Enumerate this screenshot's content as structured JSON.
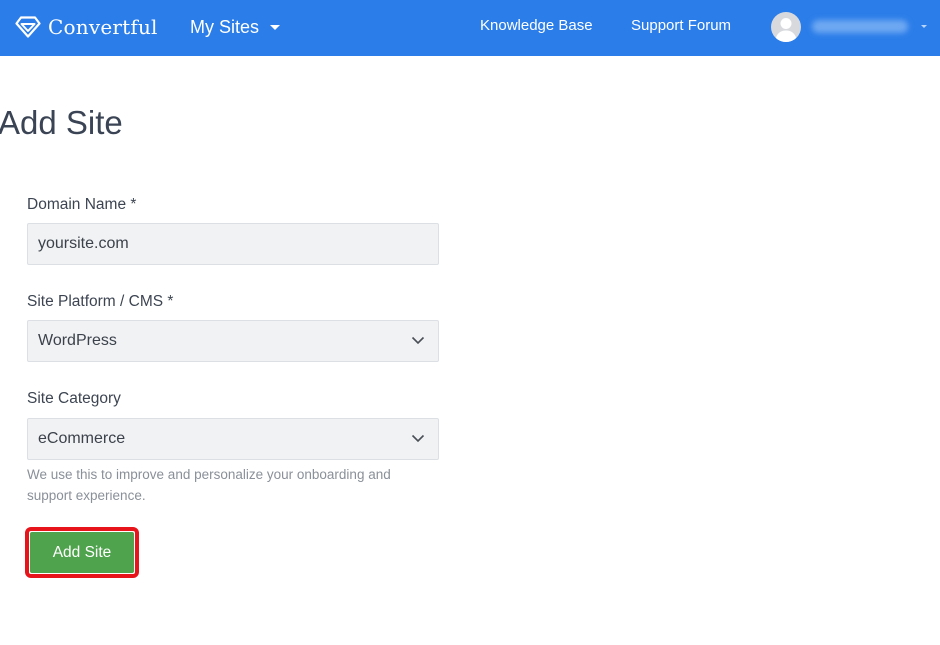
{
  "header": {
    "brand_name": "Convertful",
    "sites_menu_label": "My Sites",
    "nav_links": [
      {
        "label": "Knowledge Base"
      },
      {
        "label": "Support Forum"
      }
    ]
  },
  "page": {
    "title": "Add Site"
  },
  "form": {
    "domain": {
      "label": "Domain Name *",
      "value": "yoursite.com"
    },
    "platform": {
      "label": "Site Platform / CMS *",
      "selected": "WordPress"
    },
    "category": {
      "label": "Site Category",
      "selected": "eCommerce",
      "help": "We use this to improve and personalize your onboarding and support experience."
    },
    "submit_label": "Add Site"
  },
  "colors": {
    "header_bg": "#2b7de9",
    "button_bg": "#4ea34c",
    "highlight_border": "#e8141b"
  }
}
